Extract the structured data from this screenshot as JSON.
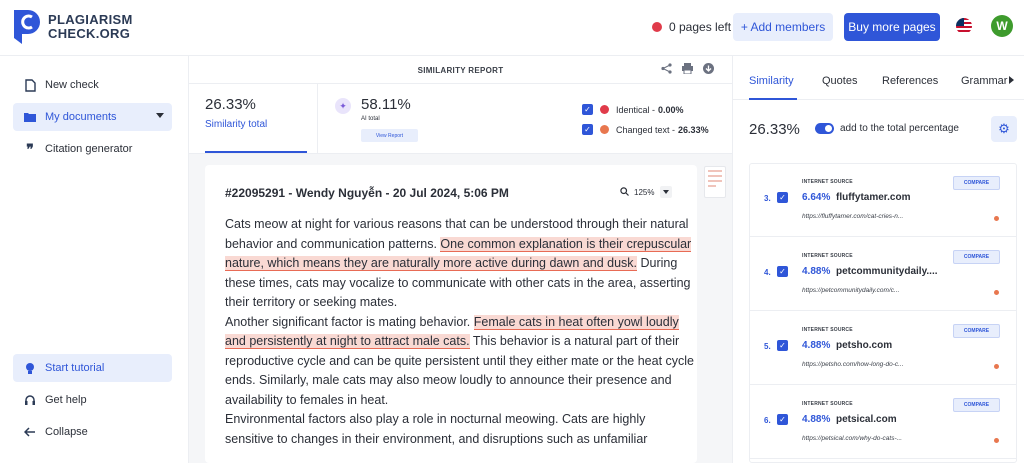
{
  "brand": {
    "line1": "PLAGIARISM",
    "line2": "CHECK.ORG"
  },
  "header": {
    "pages_left": "0 pages left",
    "add_members": "+ Add members",
    "buy_more": "Buy more pages",
    "avatar_initial": "W"
  },
  "sidebar": {
    "items": [
      {
        "label": "New check",
        "icon": "file-icon"
      },
      {
        "label": "My documents",
        "icon": "folder-icon"
      },
      {
        "label": "Citation generator",
        "icon": "quote-icon"
      }
    ],
    "bottom": [
      {
        "label": "Start tutorial",
        "icon": "lightbulb-icon"
      },
      {
        "label": "Get help",
        "icon": "headset-icon"
      },
      {
        "label": "Collapse",
        "icon": "arrow-left-icon"
      }
    ]
  },
  "report": {
    "title": "SIMILARITY REPORT",
    "similarity_pct": "26.33%",
    "similarity_label": "Similarity total",
    "ai_pct": "58.11%",
    "ai_label": "AI total",
    "view_report": "View Report",
    "legend": [
      {
        "label": "Identical - ",
        "value": "0.00%",
        "color": "#e03b4a"
      },
      {
        "label": "Changed text - ",
        "value": "26.33%",
        "color": "#e8774f"
      }
    ]
  },
  "document": {
    "title": "#22095291 - Wendy Nguyễn - 20 Jul 2024, 5:06 PM",
    "zoom": "125%",
    "p1a": "Cats meow at night for various reasons that can be understood through their natural behavior and communication patterns. ",
    "p1h": "One common explanation is their crepuscular nature, which means they are naturally more active during dawn and dusk.",
    "p1b": " During these times, cats may vocalize to communicate with other cats in the area, asserting their territory or seeking mates.",
    "p2a": "Another significant factor is mating behavior. ",
    "p2h": "Female cats in heat often yowl loudly and persistently at night to attract male cats.",
    "p2b": " This behavior is a natural part of their reproductive cycle and can be quite persistent until they either mate or the heat cycle ends. Similarly, male cats may also meow loudly to announce their presence and availability to females in heat.",
    "p3": "Environmental factors also play a role in nocturnal meowing. Cats are highly sensitive to changes in their environment, and disruptions such as unfamiliar"
  },
  "panel": {
    "tabs": [
      "Similarity",
      "Quotes",
      "References",
      "Grammar"
    ],
    "total": "26.33%",
    "toggle_label": "add to the total percentage",
    "sources": [
      {
        "num": "3.",
        "kind": "INTERNET SOURCE",
        "pct": "6.64%",
        "name": "fluffytamer.com",
        "url": "https://fluffytamer.com/cat-cries-n...",
        "compare": "COMPARE"
      },
      {
        "num": "4.",
        "kind": "INTERNET SOURCE",
        "pct": "4.88%",
        "name": "petcommunitydaily....",
        "url": "https://petcommunitydaily.com/c...",
        "compare": "COMPARE"
      },
      {
        "num": "5.",
        "kind": "INTERNET SOURCE",
        "pct": "4.88%",
        "name": "petsho.com",
        "url": "https://petsho.com/how-long-do-c...",
        "compare": "COMPARE"
      },
      {
        "num": "6.",
        "kind": "INTERNET SOURCE",
        "pct": "4.88%",
        "name": "petsical.com",
        "url": "https://petsical.com/why-do-cats-...",
        "compare": "COMPARE"
      }
    ]
  },
  "colors": {
    "accent": "#2f56d8",
    "highlight": "#f9d9d3",
    "changed": "#e8774f",
    "identical": "#e03b4a"
  }
}
